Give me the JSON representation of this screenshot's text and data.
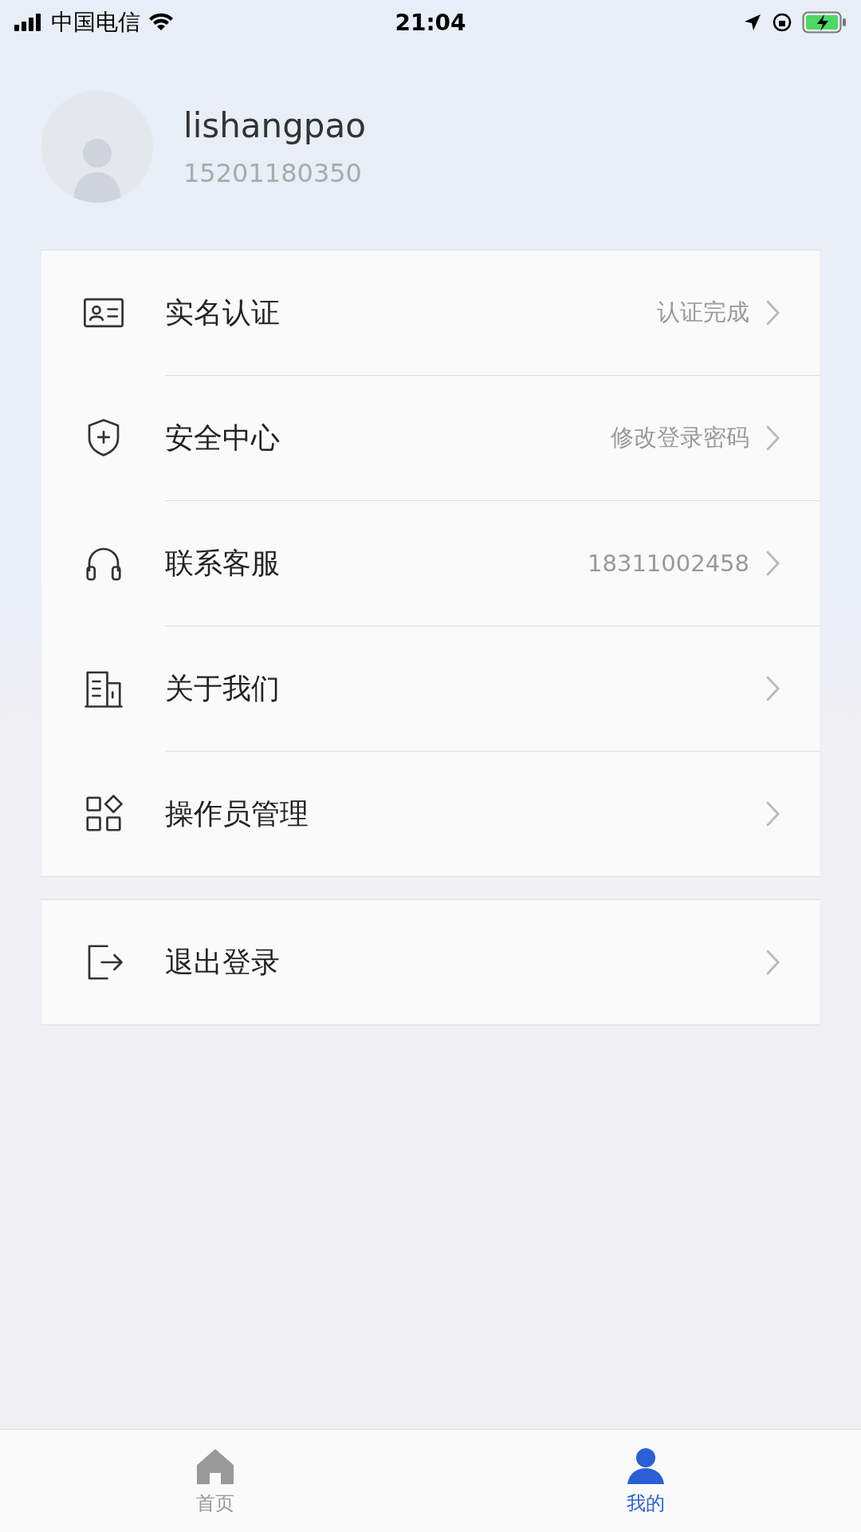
{
  "status_bar": {
    "carrier": "中国电信",
    "time": "21:04"
  },
  "profile": {
    "name": "lishangpao",
    "phone": "15201180350"
  },
  "groups": [
    [
      {
        "kind": "verify",
        "label": "实名认证",
        "value": "认证完成"
      },
      {
        "kind": "security",
        "label": "安全中心",
        "value": "修改登录密码"
      },
      {
        "kind": "service",
        "label": "联系客服",
        "value": "18311002458"
      },
      {
        "kind": "about",
        "label": "关于我们"
      },
      {
        "kind": "operators",
        "label": "操作员管理"
      }
    ],
    [
      {
        "kind": "logout",
        "label": "退出登录"
      }
    ]
  ],
  "tabs": [
    {
      "kind": "home",
      "label": "首页",
      "selected": false
    },
    {
      "kind": "mine",
      "label": "我的",
      "selected": true
    }
  ]
}
